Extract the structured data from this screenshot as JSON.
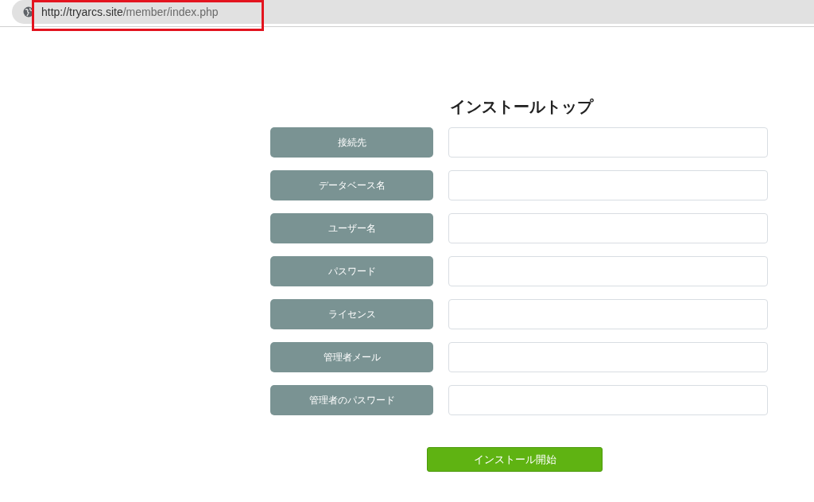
{
  "address_bar": {
    "url_host": "http://tryarcs.site",
    "url_path": "/member/index.php",
    "highlighted": true
  },
  "page": {
    "title": "インストールトップ",
    "fields": [
      {
        "label": "接続先"
      },
      {
        "label": "データベース名"
      },
      {
        "label": "ユーザー名"
      },
      {
        "label": "パスワード"
      },
      {
        "label": "ライセンス"
      },
      {
        "label": "管理者メール"
      },
      {
        "label": "管理者のパスワード"
      }
    ],
    "submit": "インストール開始"
  }
}
